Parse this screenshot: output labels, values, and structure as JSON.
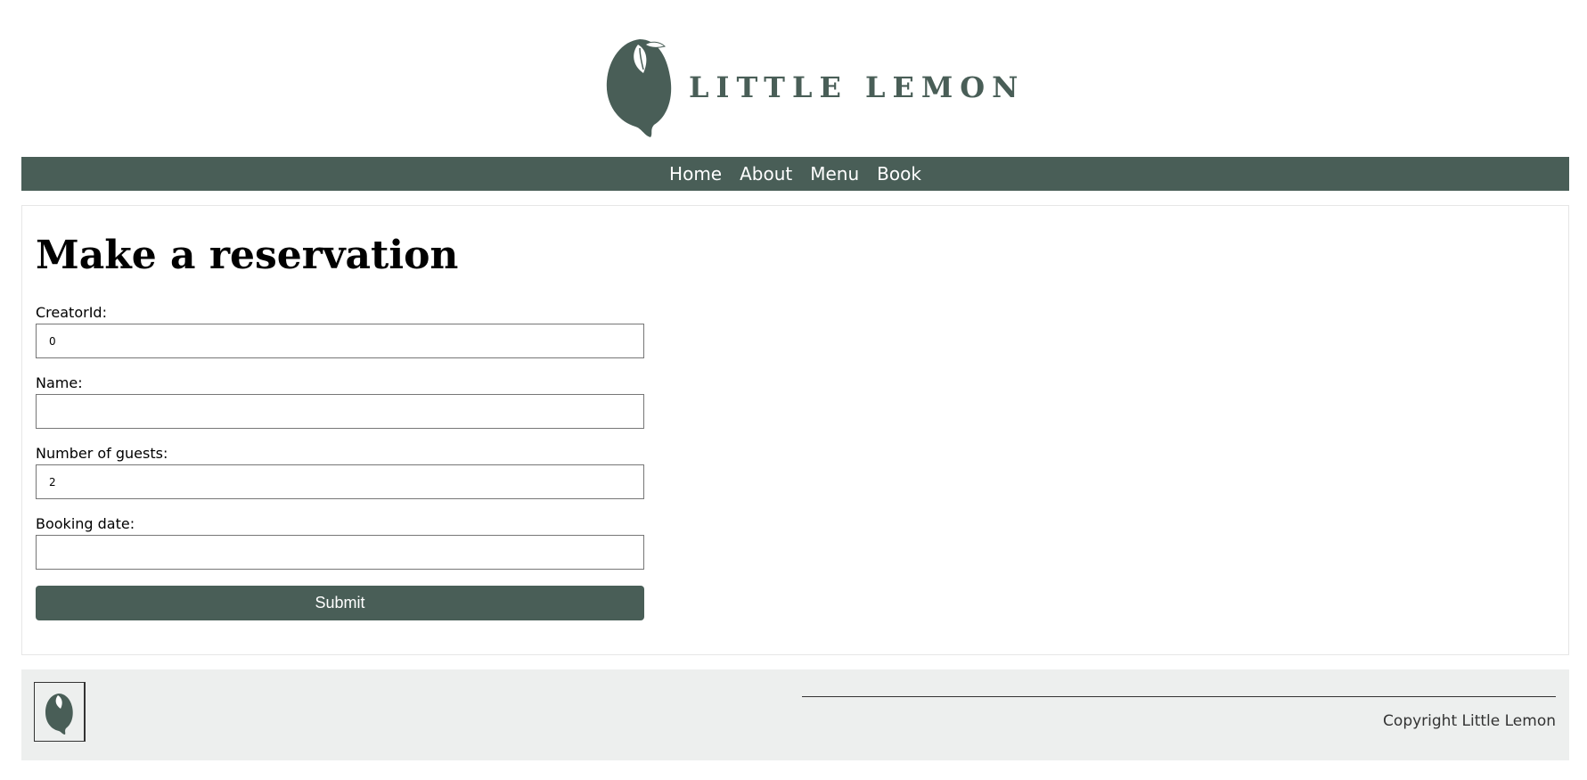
{
  "brand": {
    "name": "LITTLE LEMON",
    "color": "#495e57",
    "logo_icon": "lemon-icon"
  },
  "nav": {
    "items": [
      {
        "label": "Home"
      },
      {
        "label": "About"
      },
      {
        "label": "Menu"
      },
      {
        "label": "Book"
      }
    ]
  },
  "main": {
    "title": "Make a reservation",
    "form": {
      "creator_label": "CreatorId:",
      "creator_value": "0",
      "name_label": "Name:",
      "name_value": "",
      "guests_label": "Number of guests:",
      "guests_value": "2",
      "date_label": "Booking date:",
      "date_value": "",
      "submit_label": "Submit"
    }
  },
  "footer": {
    "copyright": "Copyright Little Lemon",
    "background": "#edefee"
  }
}
